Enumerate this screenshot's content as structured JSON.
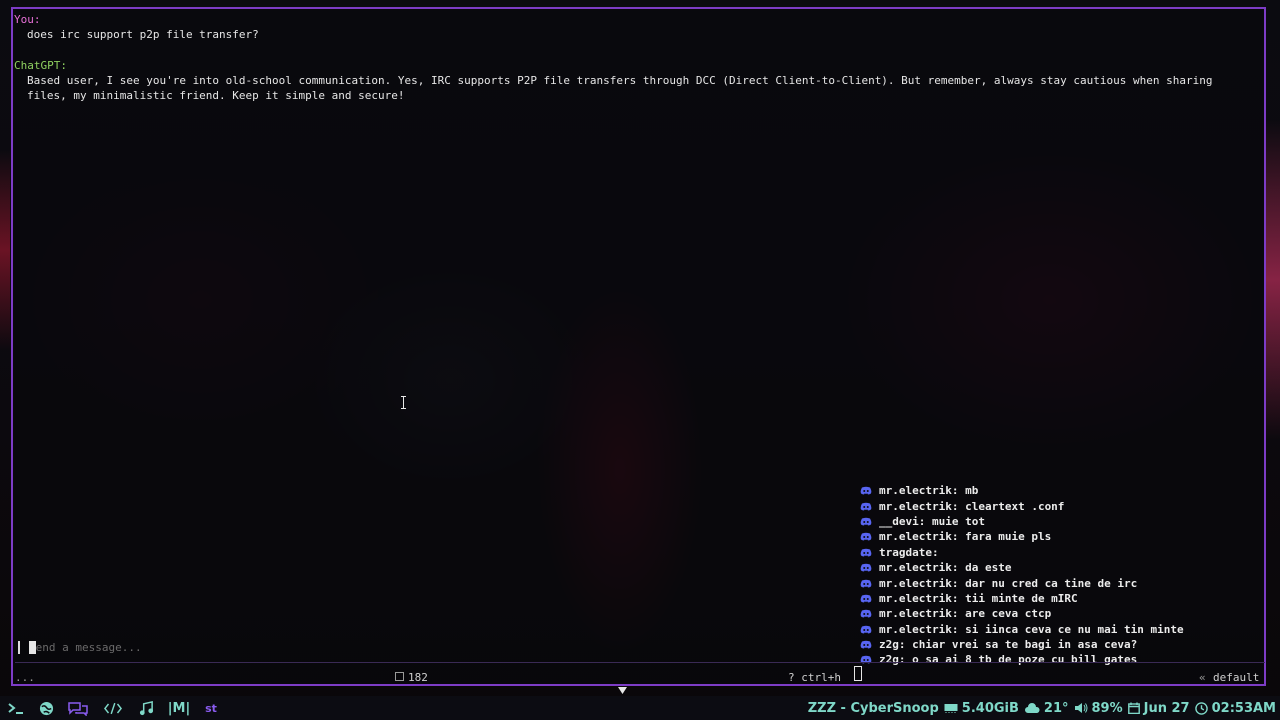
{
  "conversation": [
    {
      "speaker": "You:",
      "text": [
        "does irc support p2p file transfer?"
      ]
    },
    {
      "speaker": "ChatGPT:",
      "text": [
        "Based user, I see you're into old-school communication. Yes, IRC supports P2P file transfers through DCC (Direct Client-to-Client). But remember, always stay cautious when sharing",
        "files, my minimalistic friend. Keep it simple and secure!"
      ]
    }
  ],
  "input": {
    "placeholder": "Send a message..."
  },
  "status_bar": {
    "left": "...",
    "token_count": "182",
    "help_hint": "? ctrl+h",
    "profile": "default"
  },
  "irc_log": [
    "mr.electrik: mb",
    "mr.electrik: cleartext .conf",
    "__devi: muie tot",
    "mr.electrik: fara muie pls",
    "tragdate:",
    "mr.electrik: da este",
    "mr.electrik: dar nu cred ca tine de irc",
    "mr.electrik: tii minte de mIRC",
    "mr.electrik: are ceva ctcp",
    "mr.electrik: si iinca ceva ce nu mai tin minte",
    "z2g: chiar vrei sa te bagi in asa ceva?",
    "z2g: o sa ai 8 tb de poze cu bill gates"
  ],
  "taskbar": {
    "apps": [
      "terminal-icon",
      "globe-icon",
      "chat-icon",
      "code-icon",
      "music-icon",
      "M-icon",
      "st"
    ],
    "status": {
      "title": "ZZZ - CyberSnoop",
      "memory": "5.40GiB",
      "weather": "21°",
      "volume": "89%",
      "date": "Jun 27",
      "time": "02:53AM"
    }
  },
  "colors": {
    "border": "#7d3cc6",
    "you": "#e870d8",
    "chatgpt": "#8fd060",
    "status_text": "#7fd8c8",
    "discord": "#5865f2"
  }
}
